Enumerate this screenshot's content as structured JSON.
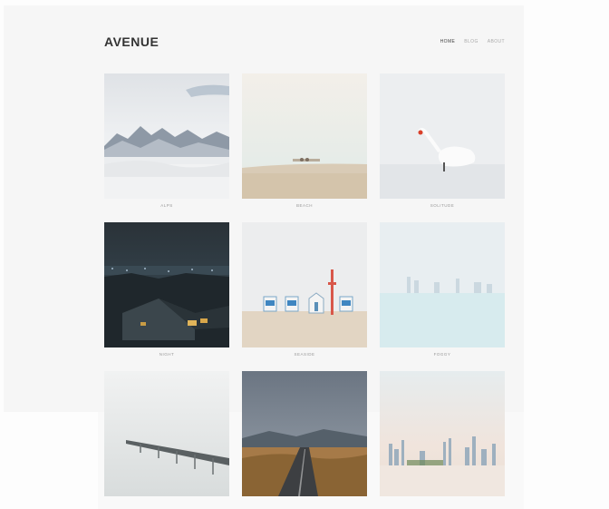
{
  "site": {
    "logo": "AVENUE",
    "nav": [
      {
        "label": "HOME",
        "active": true
      },
      {
        "label": "BLOG",
        "active": false
      },
      {
        "label": "ABOUT",
        "active": false
      }
    ]
  },
  "gallery": [
    {
      "caption": "ALPS",
      "icon": "mountain-photo"
    },
    {
      "caption": "BEACH",
      "icon": "beach-photo"
    },
    {
      "caption": "SOLITUDE",
      "icon": "swan-photo"
    },
    {
      "caption": "NIGHT",
      "icon": "night-city-photo"
    },
    {
      "caption": "SEASIDE",
      "icon": "beach-huts-photo"
    },
    {
      "caption": "FOGGY",
      "icon": "foggy-skyline-photo"
    },
    {
      "caption": "",
      "icon": "pier-photo"
    },
    {
      "caption": "",
      "icon": "road-photo"
    },
    {
      "caption": "",
      "icon": "skyline-photo"
    }
  ]
}
